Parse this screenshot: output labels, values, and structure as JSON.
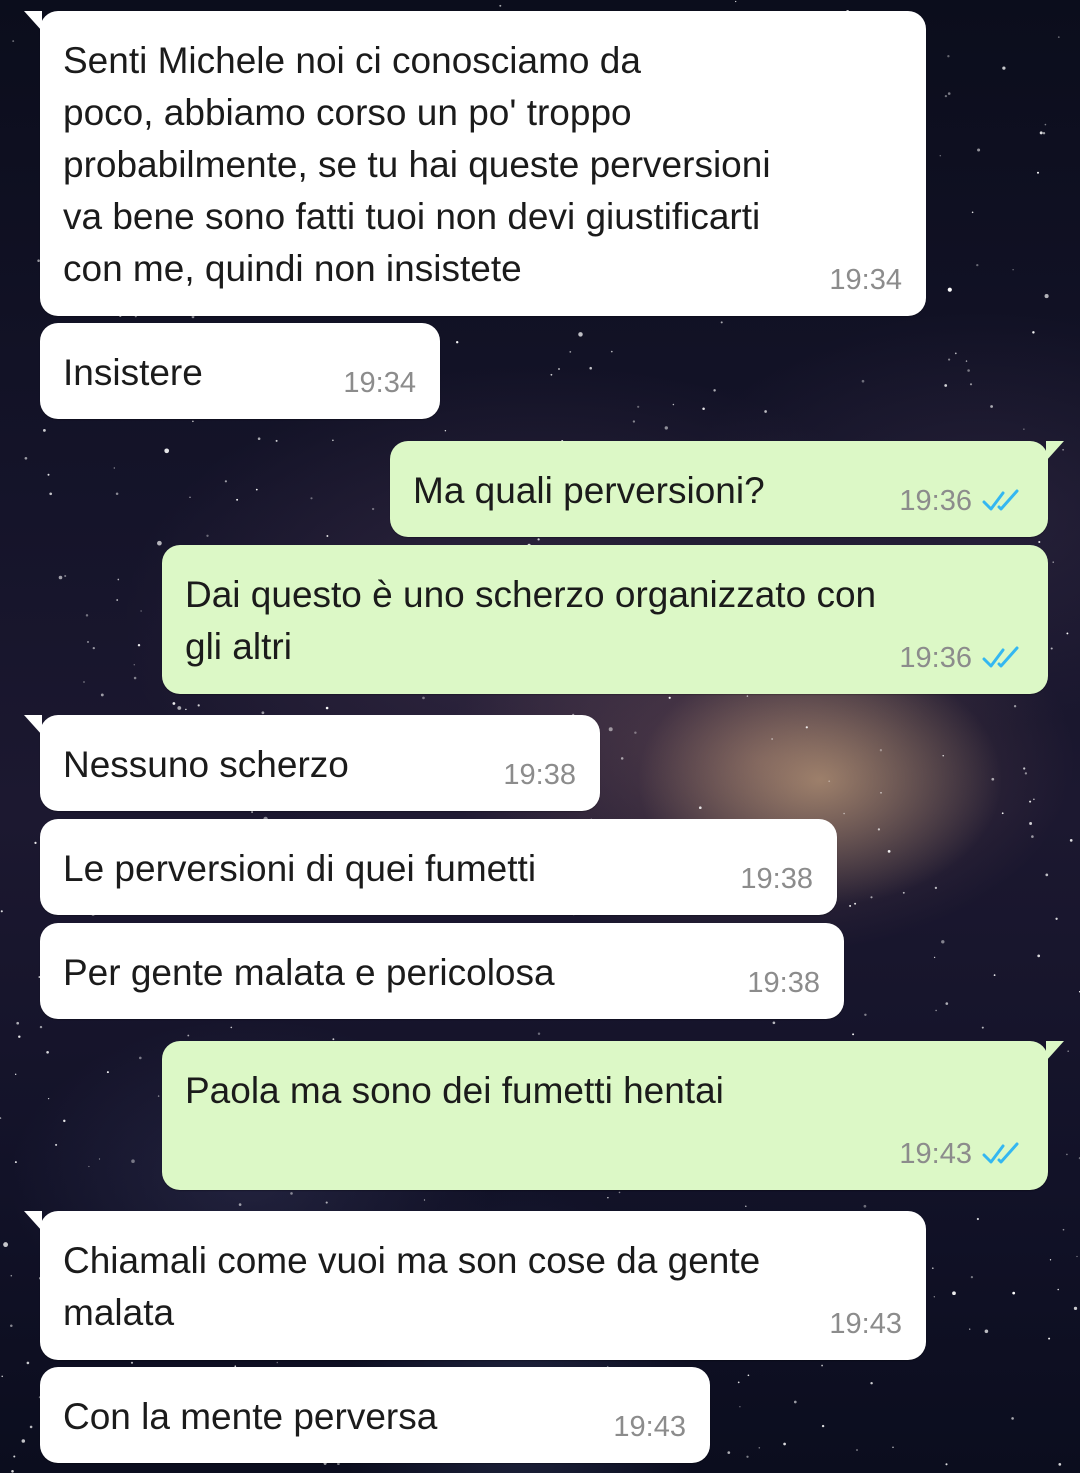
{
  "colors": {
    "incoming_bubble": "#ffffff",
    "outgoing_bubble": "#dcf8c6",
    "timestamp": "#8c8c8c",
    "read_ticks": "#34b7f1"
  },
  "messages": [
    {
      "direction": "in",
      "text": "Senti Michele noi ci conosciamo da\npoco, abbiamo corso un po' troppo\nprobabilmente, se tu hai queste perversioni\nva bene sono fatti tuoi non devi giustificarti\ncon me, quindi non insistete",
      "time": "19:34"
    },
    {
      "direction": "in",
      "text": "Insistere",
      "time": "19:34"
    },
    {
      "direction": "out",
      "text": "Ma quali perversioni?",
      "time": "19:36",
      "status": "read-ticks-icon"
    },
    {
      "direction": "out",
      "text": "Dai questo è uno scherzo organizzato con\ngli altri",
      "time": "19:36",
      "status": "read-ticks-icon"
    },
    {
      "direction": "in",
      "text": "Nessuno scherzo",
      "time": "19:38"
    },
    {
      "direction": "in",
      "text": "Le perversioni di quei fumetti",
      "time": "19:38"
    },
    {
      "direction": "in",
      "text": "Per gente malata e pericolosa",
      "time": "19:38"
    },
    {
      "direction": "out",
      "text": "Paola ma sono dei fumetti hentai",
      "time": "19:43",
      "status": "read-ticks-icon"
    },
    {
      "direction": "in",
      "text": "Chiamali come vuoi ma son cose da gente\nmalata",
      "time": "19:43"
    },
    {
      "direction": "in",
      "text": "Con la mente perversa",
      "time": "19:43"
    }
  ]
}
